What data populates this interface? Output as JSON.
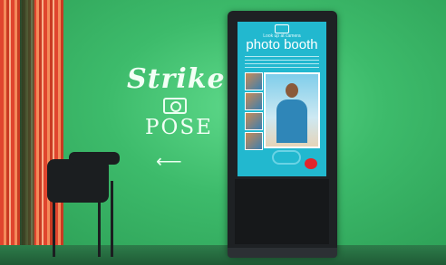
{
  "wall": {
    "script": "Strike",
    "word": "POSE"
  },
  "screen": {
    "tag": "Look up at camera",
    "title": "photo booth"
  },
  "colors": {
    "wall": "#3dbb6b",
    "screen": "#22b8cf",
    "brand": "#e2252b"
  },
  "icons": [
    "camera-icon",
    "left-arrow-icon",
    "sunglasses-icon",
    "brand-logo-icon"
  ]
}
